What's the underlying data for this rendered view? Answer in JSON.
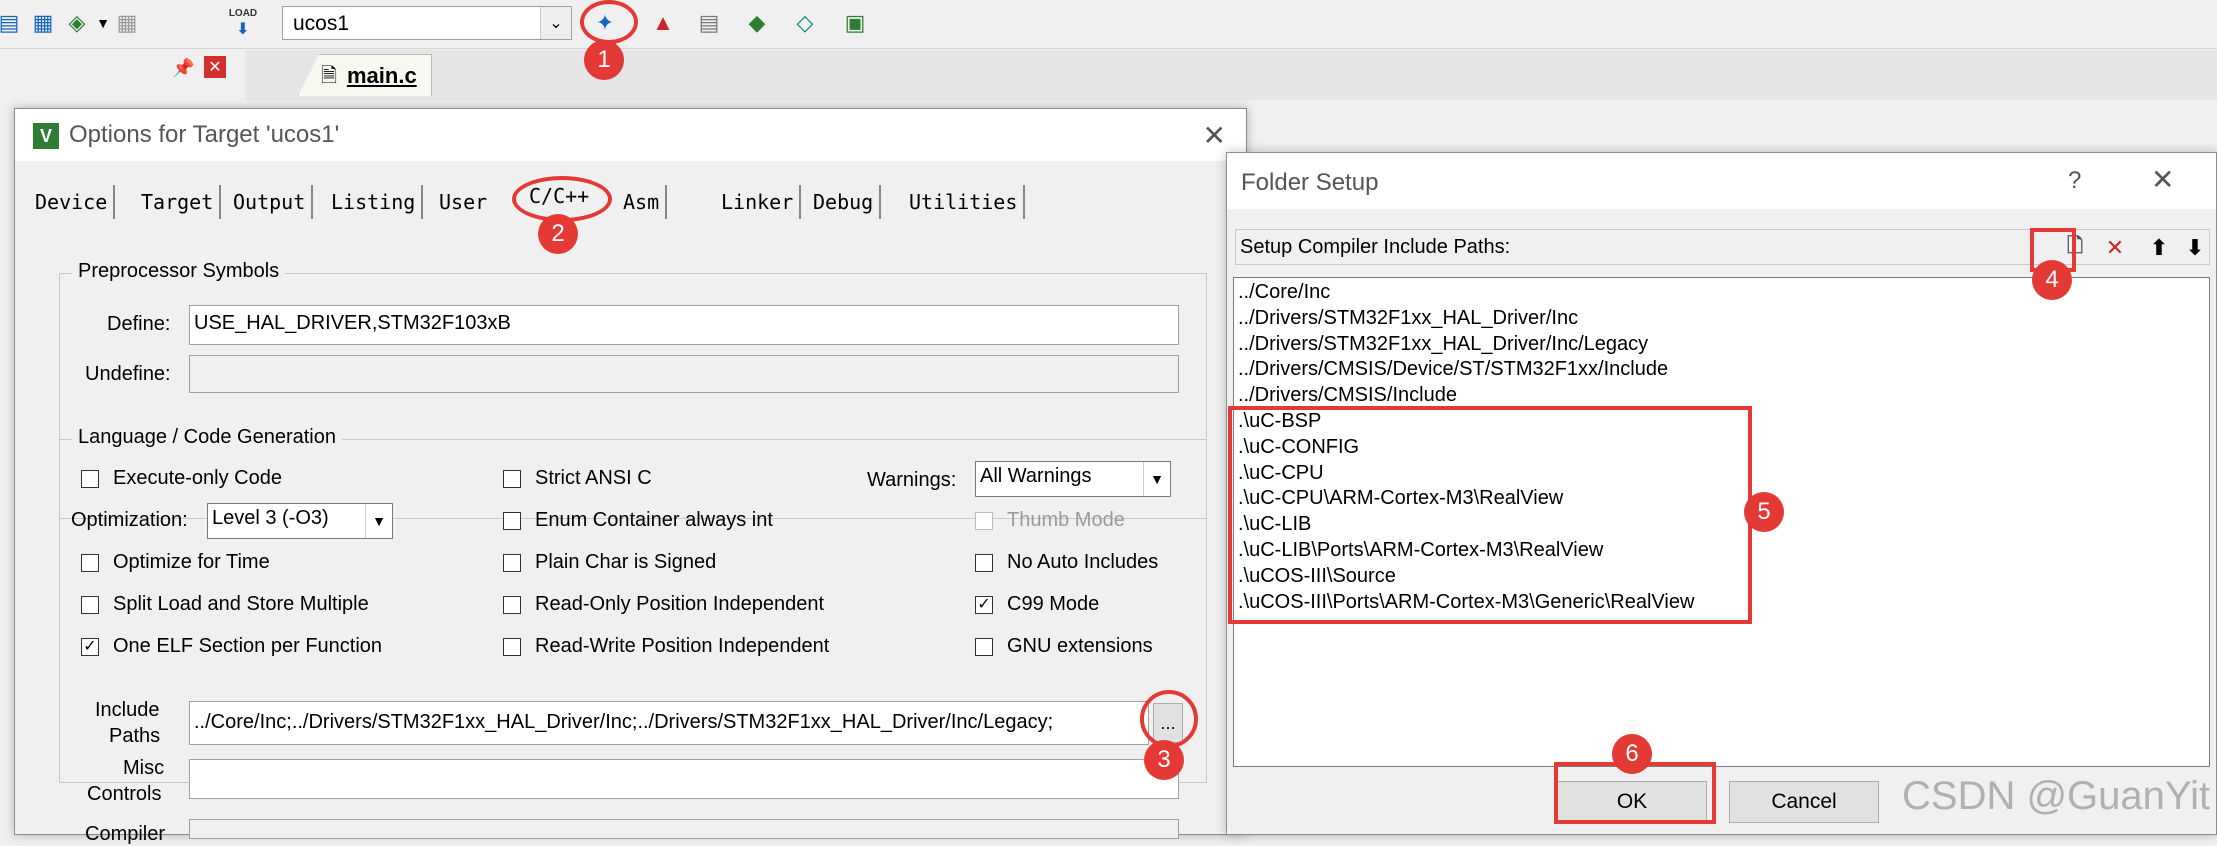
{
  "toolbar": {
    "target_name": "ucos1",
    "icons": [
      "download-icon",
      "batch-icon",
      "layers-icon",
      "options-icon",
      "load-icon",
      "magic-wand-icon",
      "components-icon",
      "books-icon",
      "diamond-icon",
      "pack-icon",
      "pack-installer-icon"
    ],
    "load_label": "LOAD"
  },
  "editor": {
    "tab_label": "main.c"
  },
  "options_dialog": {
    "title": "Options for Target 'ucos1'",
    "close_glyph": "✕",
    "tabs": [
      "Device",
      "Target",
      "Output",
      "Listing",
      "User",
      "C/C++",
      "Asm",
      "Linker",
      "Debug",
      "Utilities"
    ],
    "preprocessor": {
      "group_label": "Preprocessor Symbols",
      "define_label": "Define:",
      "define_value": "USE_HAL_DRIVER,STM32F103xB",
      "undefine_label": "Undefine:",
      "undefine_value": ""
    },
    "language": {
      "group_label": "Language / Code Generation",
      "execute_only": "Execute-only Code",
      "optimization_label": "Optimization:",
      "optimization_value": "Level 3 (-O3)",
      "optimize_time": "Optimize for Time",
      "split_load": "Split Load and Store Multiple",
      "one_elf": "One ELF Section per Function",
      "strict_ansi": "Strict ANSI C",
      "enum_container": "Enum Container always int",
      "plain_char": "Plain Char is Signed",
      "ro_pi": "Read-Only Position Independent",
      "rw_pi": "Read-Write Position Independent",
      "warnings_label": "Warnings:",
      "warnings_value": "All Warnings",
      "thumb_mode": "Thumb Mode",
      "no_auto": "No Auto Includes",
      "c99": "C99 Mode",
      "gnu": "GNU extensions",
      "check_mark": "✓"
    },
    "include_label_1": "Include",
    "include_label_2": "Paths",
    "include_value": "../Core/Inc;../Drivers/STM32F1xx_HAL_Driver/Inc;../Drivers/STM32F1xx_HAL_Driver/Inc/Legacy;",
    "browse_label": "...",
    "misc_label_1": "Misc",
    "misc_label_2": "Controls",
    "misc_value": "",
    "compiler_label": "Compiler"
  },
  "folder_dialog": {
    "title": "Folder Setup",
    "help": "?",
    "close_glyph": "✕",
    "header": "Setup Compiler Include Paths:",
    "paths": [
      "../Core/Inc",
      "../Drivers/STM32F1xx_HAL_Driver/Inc",
      "../Drivers/STM32F1xx_HAL_Driver/Inc/Legacy",
      "../Drivers/CMSIS/Device/ST/STM32F1xx/Include",
      "../Drivers/CMSIS/Include",
      ".\\uC-BSP",
      ".\\uC-CONFIG",
      ".\\uC-CPU",
      ".\\uC-CPU\\ARM-Cortex-M3\\RealView",
      ".\\uC-LIB",
      ".\\uC-LIB\\Ports\\ARM-Cortex-M3\\RealView",
      ".\\uCOS-III\\Source",
      ".\\uCOS-III\\Ports\\ARM-Cortex-M3\\Generic\\RealView"
    ],
    "ok_label": "OK",
    "cancel_label": "Cancel"
  },
  "annotations": [
    "1",
    "2",
    "3",
    "4",
    "5",
    "6"
  ],
  "annotation_color": "#e53935",
  "watermark": "CSDN @GuanYit"
}
